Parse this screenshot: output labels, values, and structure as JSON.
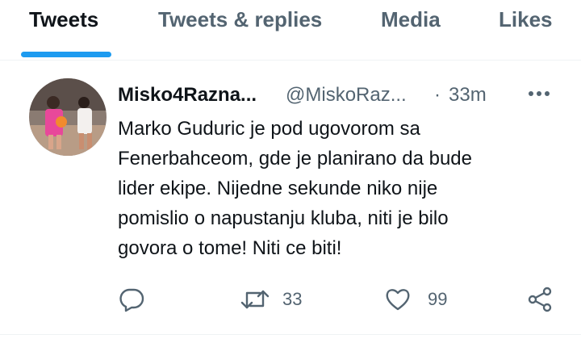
{
  "tabs": [
    {
      "label": "Tweets"
    },
    {
      "label": "Tweets & replies"
    },
    {
      "label": "Media"
    },
    {
      "label": "Likes"
    }
  ],
  "accent_color": "#1d9bf0",
  "tweet": {
    "display_name": "Misko4Razna...",
    "handle": "@MiskoRaz...",
    "separator": "·",
    "time": "33m",
    "text": "Marko Guduric je pod ugovorom sa\nFenerbahceom, gde je planirano da bude\nlider ekipe. Nijedne sekunde niko nije\npomislio o napustanju kluba, niti je bilo\ngovora o tome! Niti ce biti!",
    "actions": {
      "reply": {
        "icon": "reply-icon",
        "count": ""
      },
      "retweet": {
        "icon": "retweet-icon",
        "count": "33"
      },
      "like": {
        "icon": "heart-icon",
        "count": "99"
      },
      "share": {
        "icon": "share-icon"
      }
    }
  }
}
